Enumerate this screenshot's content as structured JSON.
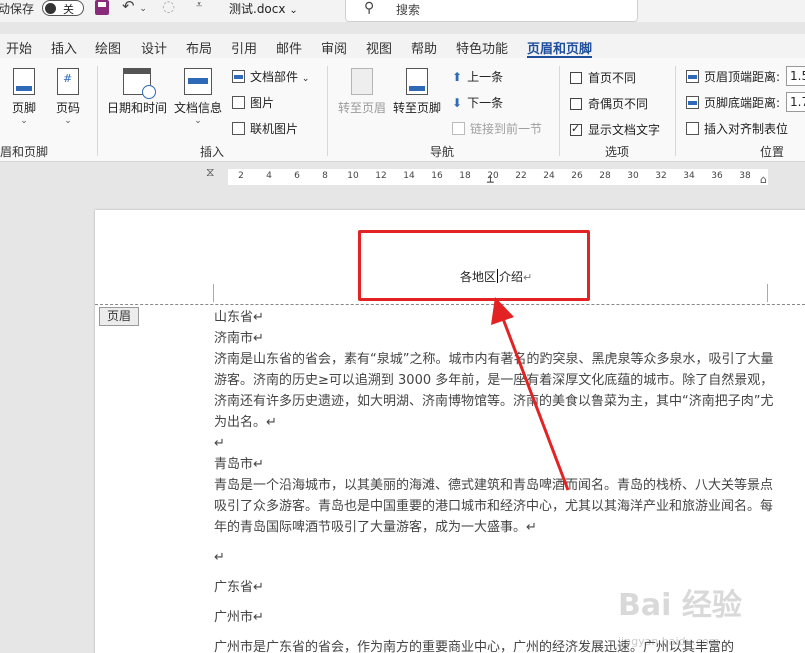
{
  "titlebar": {
    "autosave_label": "动保存",
    "toggle_label": "关",
    "filename": "测试.docx",
    "filename_caret": "⌄",
    "search_placeholder": "搜索"
  },
  "tabs": [
    "开始",
    "插入",
    "绘图",
    "设计",
    "布局",
    "引用",
    "邮件",
    "审阅",
    "视图",
    "帮助",
    "特色功能",
    "页眉和页脚"
  ],
  "active_tab": "页眉和页脚",
  "ribbon": {
    "header_footer_group": {
      "footer_label": "页脚",
      "page_number_label": "页码",
      "group_label": "眉和页脚"
    },
    "insert_group": {
      "datetime_label": "日期和时间",
      "docinfo_label": "文档信息",
      "quickparts_label": "文档部件",
      "picture_label": "图片",
      "online_picture_label": "联机图片",
      "group_label": "插入"
    },
    "nav_group": {
      "goto_header_label": "转至页眉",
      "goto_footer_label": "转至页脚",
      "previous_label": "上一条",
      "next_label": "下一条",
      "link_previous_label": "链接到前一节",
      "group_label": "导航"
    },
    "options_group": {
      "different_first_label": "首页不同",
      "different_odd_even_label": "奇偶页不同",
      "show_doc_text_label": "显示文档文字",
      "group_label": "选项"
    },
    "position_group": {
      "header_top_label": "页眉顶端距离:",
      "header_top_value": "1.5",
      "footer_bottom_label": "页脚底端距离:",
      "footer_bottom_value": "1.7",
      "insert_align_tab_label": "插入对齐制表位",
      "group_label": "位置"
    }
  },
  "ruler": {
    "ticks": [
      "2",
      "4",
      "6",
      "8",
      "10",
      "12",
      "14",
      "16",
      "18",
      "20",
      "22",
      "24",
      "26",
      "28",
      "30",
      "32",
      "34",
      "36",
      "38"
    ]
  },
  "document": {
    "header_tag": "页眉",
    "header_text_before": "各地区",
    "header_text_after": "介绍",
    "paragraph_mark": "↵",
    "paragraphs": [
      "山东省↵",
      "济南市↵",
      "济南是山东省的省会，素有“泉城”之称。城市内有著名的趵突泉、黑虎泉等众多泉水，吸引了大量游客。济南的历史≥可以追溯到 3000 多年前，是一座有着深厚文化底蕴的城市。除了自然景观，济南还有许多历史遗迹，如大明湖、济南博物馆等。济南的美食以鲁菜为主，其中“济南把子肉”尤为出名。↵",
      "↵",
      "青岛市↵",
      "青岛是一个沿海城市，以其美丽的海滩、德式建筑和青岛啤酒而闻名。青岛的栈桥、八大关等景点吸引了众多游客。青岛也是中国重要的港口城市和经济中心，尤其以其海洋产业和旅游业闻名。每年的青岛国际啤酒节吸引了大量游客，成为一大盛事。↵",
      "",
      "↵",
      "",
      "广东省↵",
      "",
      "广州市↵",
      "",
      "广州市是广东省的省会，作为南方的重要商业中心，广州的经济发展迅速。广州以其丰富的"
    ]
  },
  "watermark": {
    "main": "Bai 经验",
    "sub": "jingyan.baidu.com"
  },
  "colors": {
    "accent": "#1f4e9a",
    "highlight_box": "#e32323",
    "arrow": "#e32323"
  }
}
